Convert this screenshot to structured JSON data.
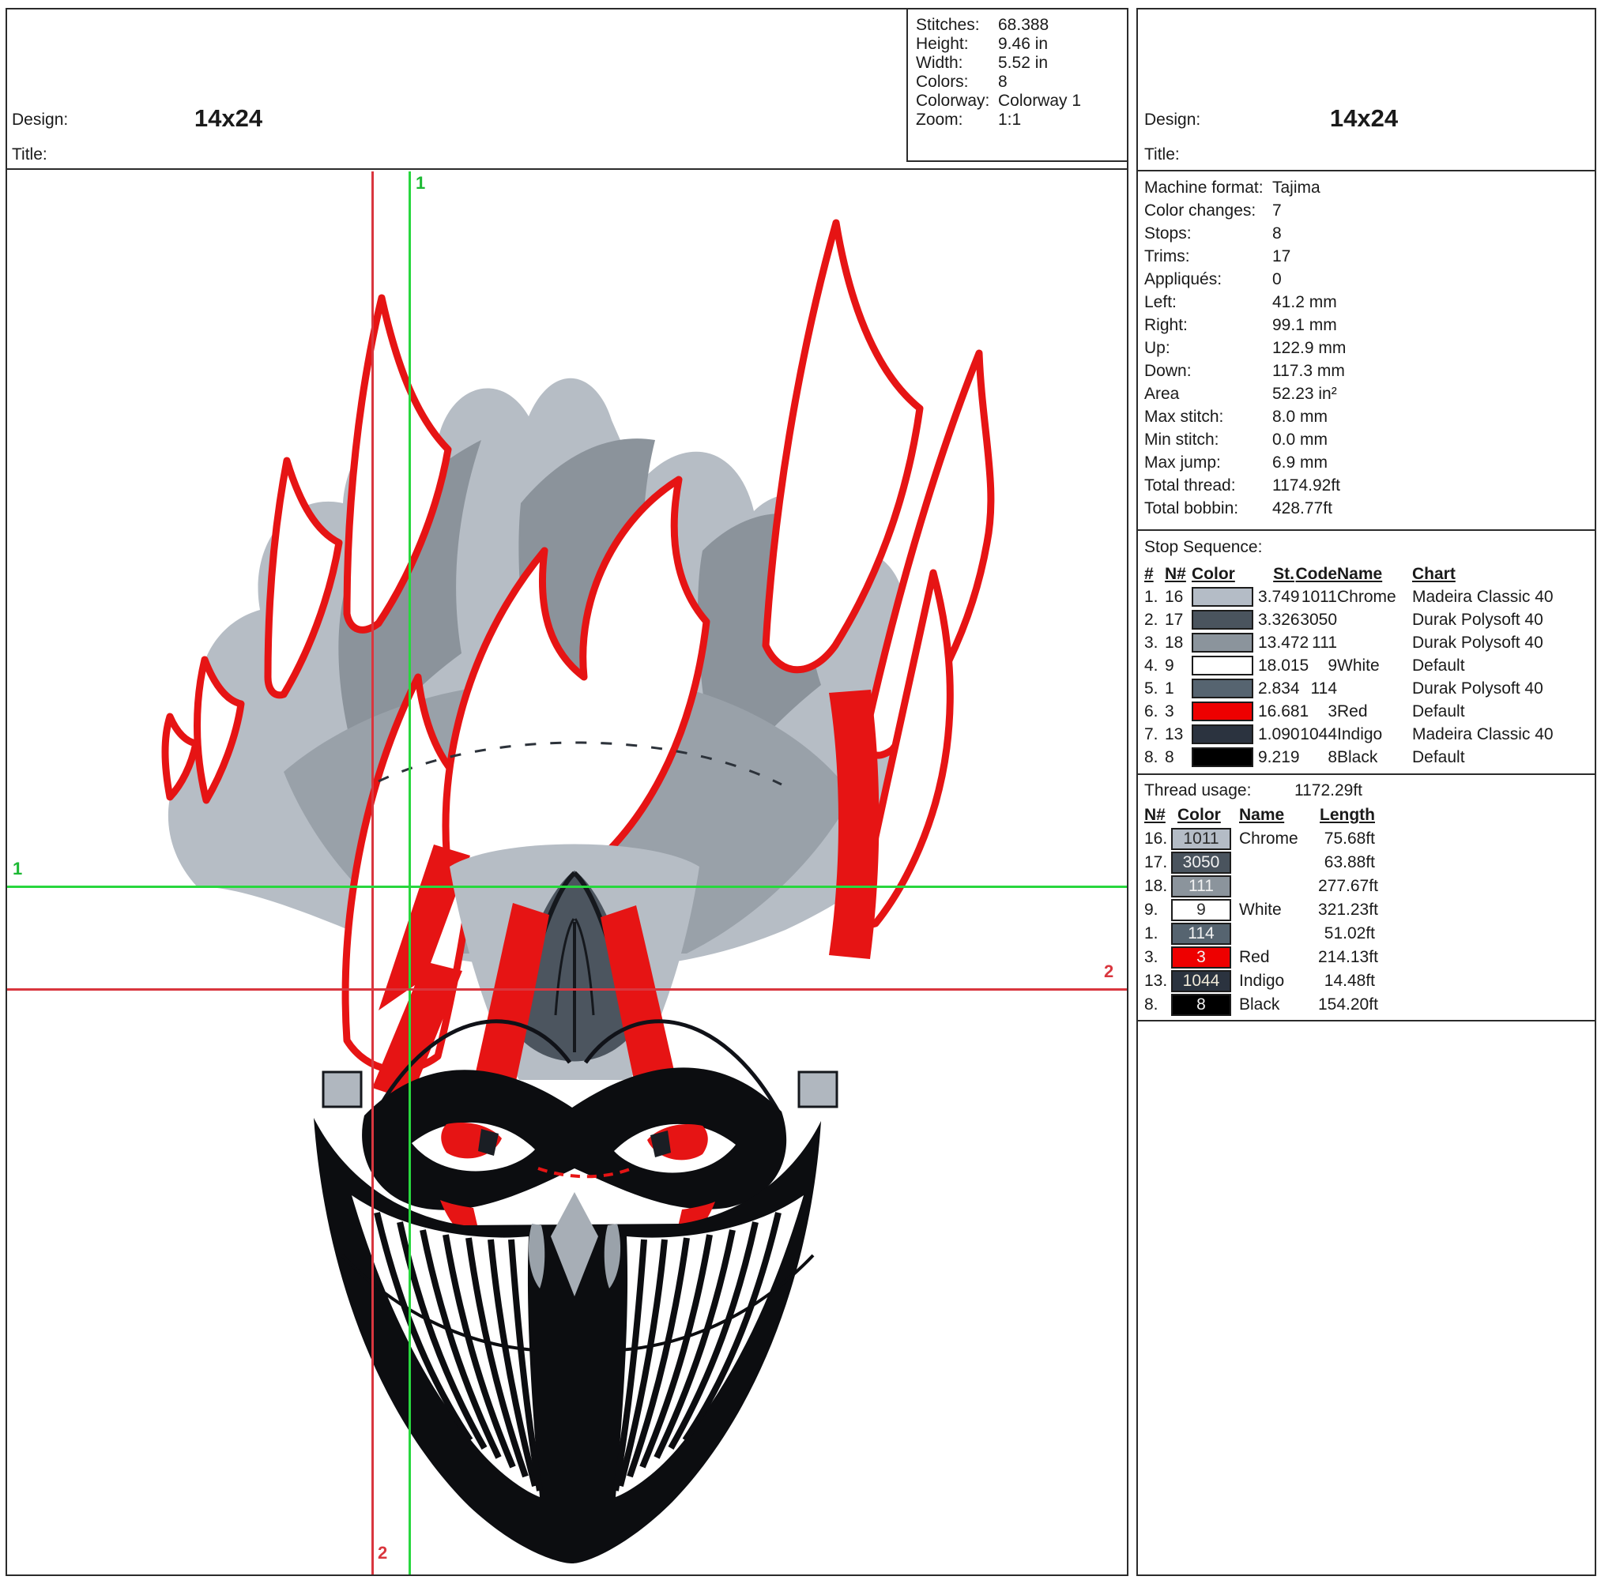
{
  "left": {
    "design_label": "Design:",
    "design_value": "14x24",
    "title_label": "Title:",
    "stats": [
      {
        "label": "Stitches:",
        "value": "68.388"
      },
      {
        "label": "Height:",
        "value": "9.46 in"
      },
      {
        "label": "Width:",
        "value": "5.52 in"
      },
      {
        "label": "Colors:",
        "value": "8"
      },
      {
        "label": "Colorway:",
        "value": "Colorway 1"
      },
      {
        "label": "Zoom:",
        "value": "1:1"
      }
    ],
    "guides": {
      "top": "1",
      "left": "1",
      "bottom": "2",
      "right": "2"
    }
  },
  "right": {
    "design_label": "Design:",
    "design_value": "14x24",
    "title_label": "Title:",
    "machine_info": [
      {
        "label": "Machine format:",
        "value": "Tajima"
      },
      {
        "label": "Color changes:",
        "value": "7"
      },
      {
        "label": "Stops:",
        "value": "8"
      },
      {
        "label": "Trims:",
        "value": "17"
      },
      {
        "label": "Appliqués:",
        "value": "0"
      },
      {
        "label": "Left:",
        "value": "41.2 mm"
      },
      {
        "label": "Right:",
        "value": "99.1 mm"
      },
      {
        "label": "Up:",
        "value": "122.9 mm"
      },
      {
        "label": "Down:",
        "value": "117.3 mm"
      },
      {
        "label": "Area",
        "value": "52.23 in²"
      },
      {
        "label": "Max stitch:",
        "value": "8.0 mm"
      },
      {
        "label": "Min stitch:",
        "value": "0.0 mm"
      },
      {
        "label": "Max jump:",
        "value": "6.9 mm"
      },
      {
        "label": "Total thread:",
        "value": "1174.92ft"
      },
      {
        "label": "Total bobbin:",
        "value": "428.77ft"
      }
    ],
    "stop_sequence": {
      "title": "Stop Sequence:",
      "headers": {
        "num": "#",
        "n": "N#",
        "color": "Color",
        "st": "St.",
        "code": "Code",
        "name": "Name",
        "chart": "Chart"
      },
      "rows": [
        {
          "num": "1.",
          "n": "16",
          "color": "#b4bcc6",
          "st": "3.749",
          "code": "1011",
          "name": "Chrome",
          "chart": "Madeira Classic 40"
        },
        {
          "num": "2.",
          "n": "17",
          "color": "#4a545e",
          "st": "3.326",
          "code": "3050",
          "name": "",
          "chart": "Durak Polysoft 40"
        },
        {
          "num": "3.",
          "n": "18",
          "color": "#8b949c",
          "st": "13.472",
          "code": "111",
          "name": "",
          "chart": "Durak Polysoft 40"
        },
        {
          "num": "4.",
          "n": "9",
          "color": "#ffffff",
          "st": "18.015",
          "code": "9",
          "name": "White",
          "chart": "Default"
        },
        {
          "num": "5.",
          "n": "1",
          "color": "#566470",
          "st": "2.834",
          "code": "114",
          "name": "",
          "chart": "Durak Polysoft 40"
        },
        {
          "num": "6.",
          "n": "3",
          "color": "#ee0000",
          "st": "16.681",
          "code": "3",
          "name": "Red",
          "chart": "Default"
        },
        {
          "num": "7.",
          "n": "13",
          "color": "#2b333f",
          "st": "1.090",
          "code": "1044",
          "name": "Indigo",
          "chart": "Madeira Classic 40"
        },
        {
          "num": "8.",
          "n": "8",
          "color": "#000000",
          "st": "9.219",
          "code": "8",
          "name": "Black",
          "chart": "Default"
        }
      ]
    },
    "thread_usage": {
      "title": "Thread usage:",
      "total": "1172.29ft",
      "headers": {
        "n": "N#",
        "color": "Color",
        "name": "Name",
        "length": "Length"
      },
      "rows": [
        {
          "num": "16.",
          "code": "1011",
          "color": "#b4bcc6",
          "fg": "#2a2a2a",
          "name": "Chrome",
          "length": "75.68ft"
        },
        {
          "num": "17.",
          "code": "3050",
          "color": "#4a545e",
          "fg": "#f2f2f2",
          "name": "",
          "length": "63.88ft"
        },
        {
          "num": "18.",
          "code": "111",
          "color": "#8b949c",
          "fg": "#f2f2f2",
          "name": "",
          "length": "277.67ft"
        },
        {
          "num": "9.",
          "code": "9",
          "color": "#ffffff",
          "fg": "#2a2a2a",
          "name": "White",
          "length": "321.23ft"
        },
        {
          "num": "1.",
          "code": "114",
          "color": "#566470",
          "fg": "#f2f2f2",
          "name": "",
          "length": "51.02ft"
        },
        {
          "num": "3.",
          "code": "3",
          "color": "#ee0000",
          "fg": "#f2f2f2",
          "name": "Red",
          "length": "214.13ft"
        },
        {
          "num": "13.",
          "code": "1044",
          "color": "#2b333f",
          "fg": "#f0e9d8",
          "name": "Indigo",
          "length": "14.48ft"
        },
        {
          "num": "8.",
          "code": "8",
          "color": "#000000",
          "fg": "#f2f2f2",
          "name": "Black",
          "length": "154.20ft"
        }
      ]
    }
  },
  "colors": {
    "guide_green": "#28d73e",
    "guide_red": "#d9363e",
    "flame_red": "#e61414",
    "hair_light_gray": "#b6bdc5",
    "hair_mid_gray": "#8b939b",
    "mask_black": "#0c0d10",
    "border": "#2b2b2b"
  }
}
